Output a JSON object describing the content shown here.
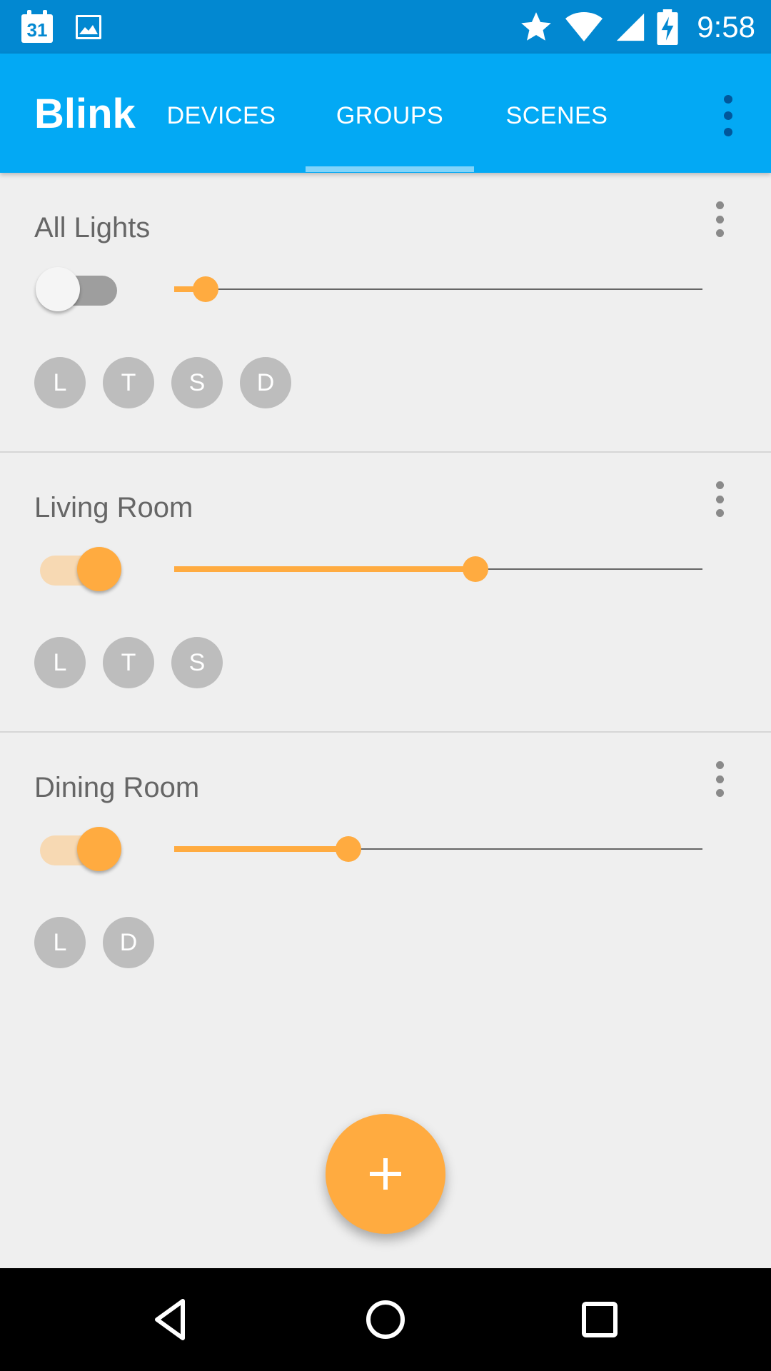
{
  "status_bar": {
    "calendar_day": "31",
    "time": "9:58",
    "icons": [
      "calendar-icon",
      "image-icon",
      "star-icon",
      "wifi-icon",
      "cell-signal-icon",
      "battery-charging-icon"
    ]
  },
  "app_bar": {
    "title": "Blink",
    "tabs": [
      {
        "label": "DEVICES",
        "selected": false
      },
      {
        "label": "GROUPS",
        "selected": true
      },
      {
        "label": "SCENES",
        "selected": false
      }
    ],
    "menu_icon": "overflow-menu-icon"
  },
  "groups": [
    {
      "name": "All Lights",
      "on": false,
      "brightness": 0.06,
      "members": [
        "L",
        "T",
        "S",
        "D"
      ]
    },
    {
      "name": "Living Room",
      "on": true,
      "brightness": 0.57,
      "members": [
        "L",
        "T",
        "S"
      ]
    },
    {
      "name": "Dining Room",
      "on": true,
      "brightness": 0.33,
      "members": [
        "L",
        "D"
      ]
    }
  ],
  "fab": {
    "icon": "plus-icon"
  },
  "nav_bar": {
    "icons": [
      "back-icon",
      "home-icon",
      "recents-icon"
    ]
  },
  "colors": {
    "status_bar": "#0288d1",
    "app_bar": "#03a9f4",
    "accent": "#ffab40",
    "background": "#efefef",
    "chip": "#bdbdbd"
  }
}
